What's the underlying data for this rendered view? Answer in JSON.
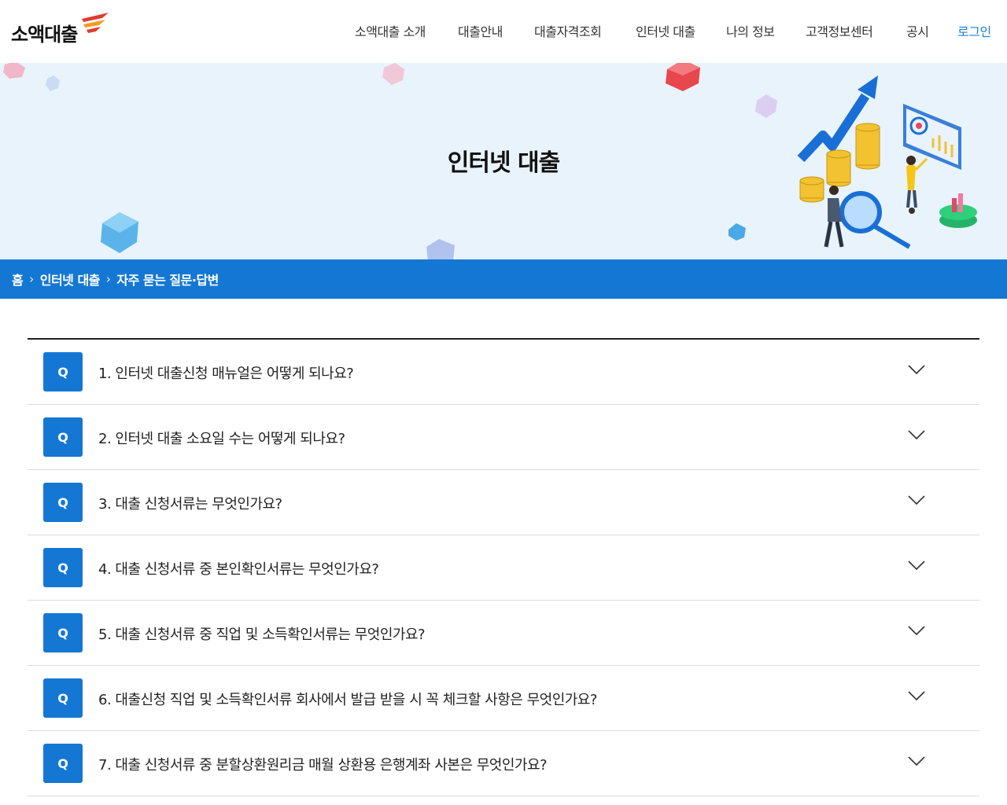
{
  "logo": {
    "text": "소액대출"
  },
  "nav": [
    {
      "label": "소액대출 소개"
    },
    {
      "label": "대출안내"
    },
    {
      "label": "대출자격조회"
    },
    {
      "label": "인터넷 대출"
    },
    {
      "label": "나의 정보"
    },
    {
      "label": "고객정보센터"
    },
    {
      "label": "공시"
    },
    {
      "label": "로그인"
    }
  ],
  "hero": {
    "title": "인터넷 대출"
  },
  "breadcrumb": {
    "home": "홈",
    "section": "인터넷 대출",
    "current": "자주 묻는 질문·답변"
  },
  "faq": {
    "badge": "Q",
    "items": [
      {
        "question": "1.  인터넷 대출신청 매뉴얼은 어떻게 되나요?"
      },
      {
        "question": "2. 인터넷 대출 소요일 수는 어떻게 되나요?"
      },
      {
        "question": "3. 대출 신청서류는 무엇인가요?"
      },
      {
        "question": "4. 대출 신청서류 중 본인확인서류는 무엇인가요?"
      },
      {
        "question": "5. 대출 신청서류 중 직업 및 소득확인서류는 무엇인가요?"
      },
      {
        "question": "6. 대출신청 직업 및 소득확인서류 회사에서 발급 받을 시 꼭 체크할 사항은 무엇인가요?"
      },
      {
        "question": "7. 대출 신청서류 중 분할상환원리금 매월 상환용 은행계좌 사본은 무엇인가요?"
      }
    ]
  },
  "colors": {
    "primary": "#1477d3",
    "hero_bg": "#e8f3fb",
    "logo_red": "#e03b2f",
    "logo_orange": "#f59a23"
  }
}
